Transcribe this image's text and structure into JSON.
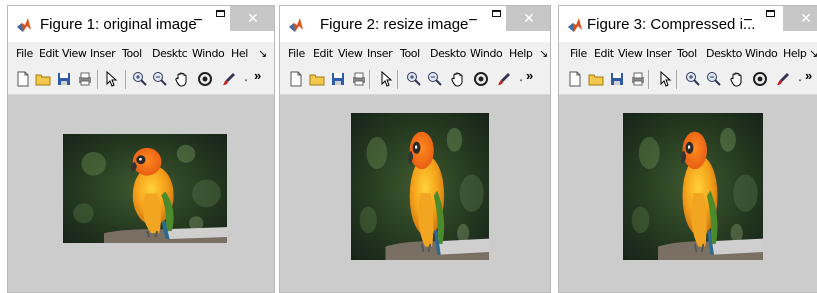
{
  "windows": [
    {
      "title": "Figure 1: original image",
      "close_glyph": "✕",
      "minimize_glyph": "−"
    },
    {
      "title": "Figure 2: resize image",
      "close_glyph": "✕",
      "minimize_glyph": "−"
    },
    {
      "title": "Figure 3: Compressed i...",
      "close_glyph": "✕",
      "minimize_glyph": "−"
    }
  ],
  "menus": [
    [
      "File",
      "Edit",
      "View",
      "Inser",
      "Tool",
      "Desktc",
      "Windo",
      "Hel",
      "↘"
    ],
    [
      "File",
      "Edit",
      "View",
      "Inser",
      "Tool",
      "Deskto",
      "Windo",
      "Help",
      "↘"
    ],
    [
      "File",
      "Edit",
      "View",
      "Inser",
      "Tool",
      "Deskto",
      "Windo",
      "Help",
      "↘"
    ]
  ],
  "toolbar": {
    "icons": [
      "new-figure-icon",
      "open-icon",
      "save-icon",
      "print-icon",
      "pointer-icon",
      "zoom-in-icon",
      "zoom-out-icon",
      "pan-icon",
      "rotate-3d-icon",
      "brush-icon",
      "dropdown-arrow-icon"
    ],
    "overflow_label": "»",
    "dropdown_label": "▾"
  },
  "image": {
    "subject": "parrot-photo"
  }
}
